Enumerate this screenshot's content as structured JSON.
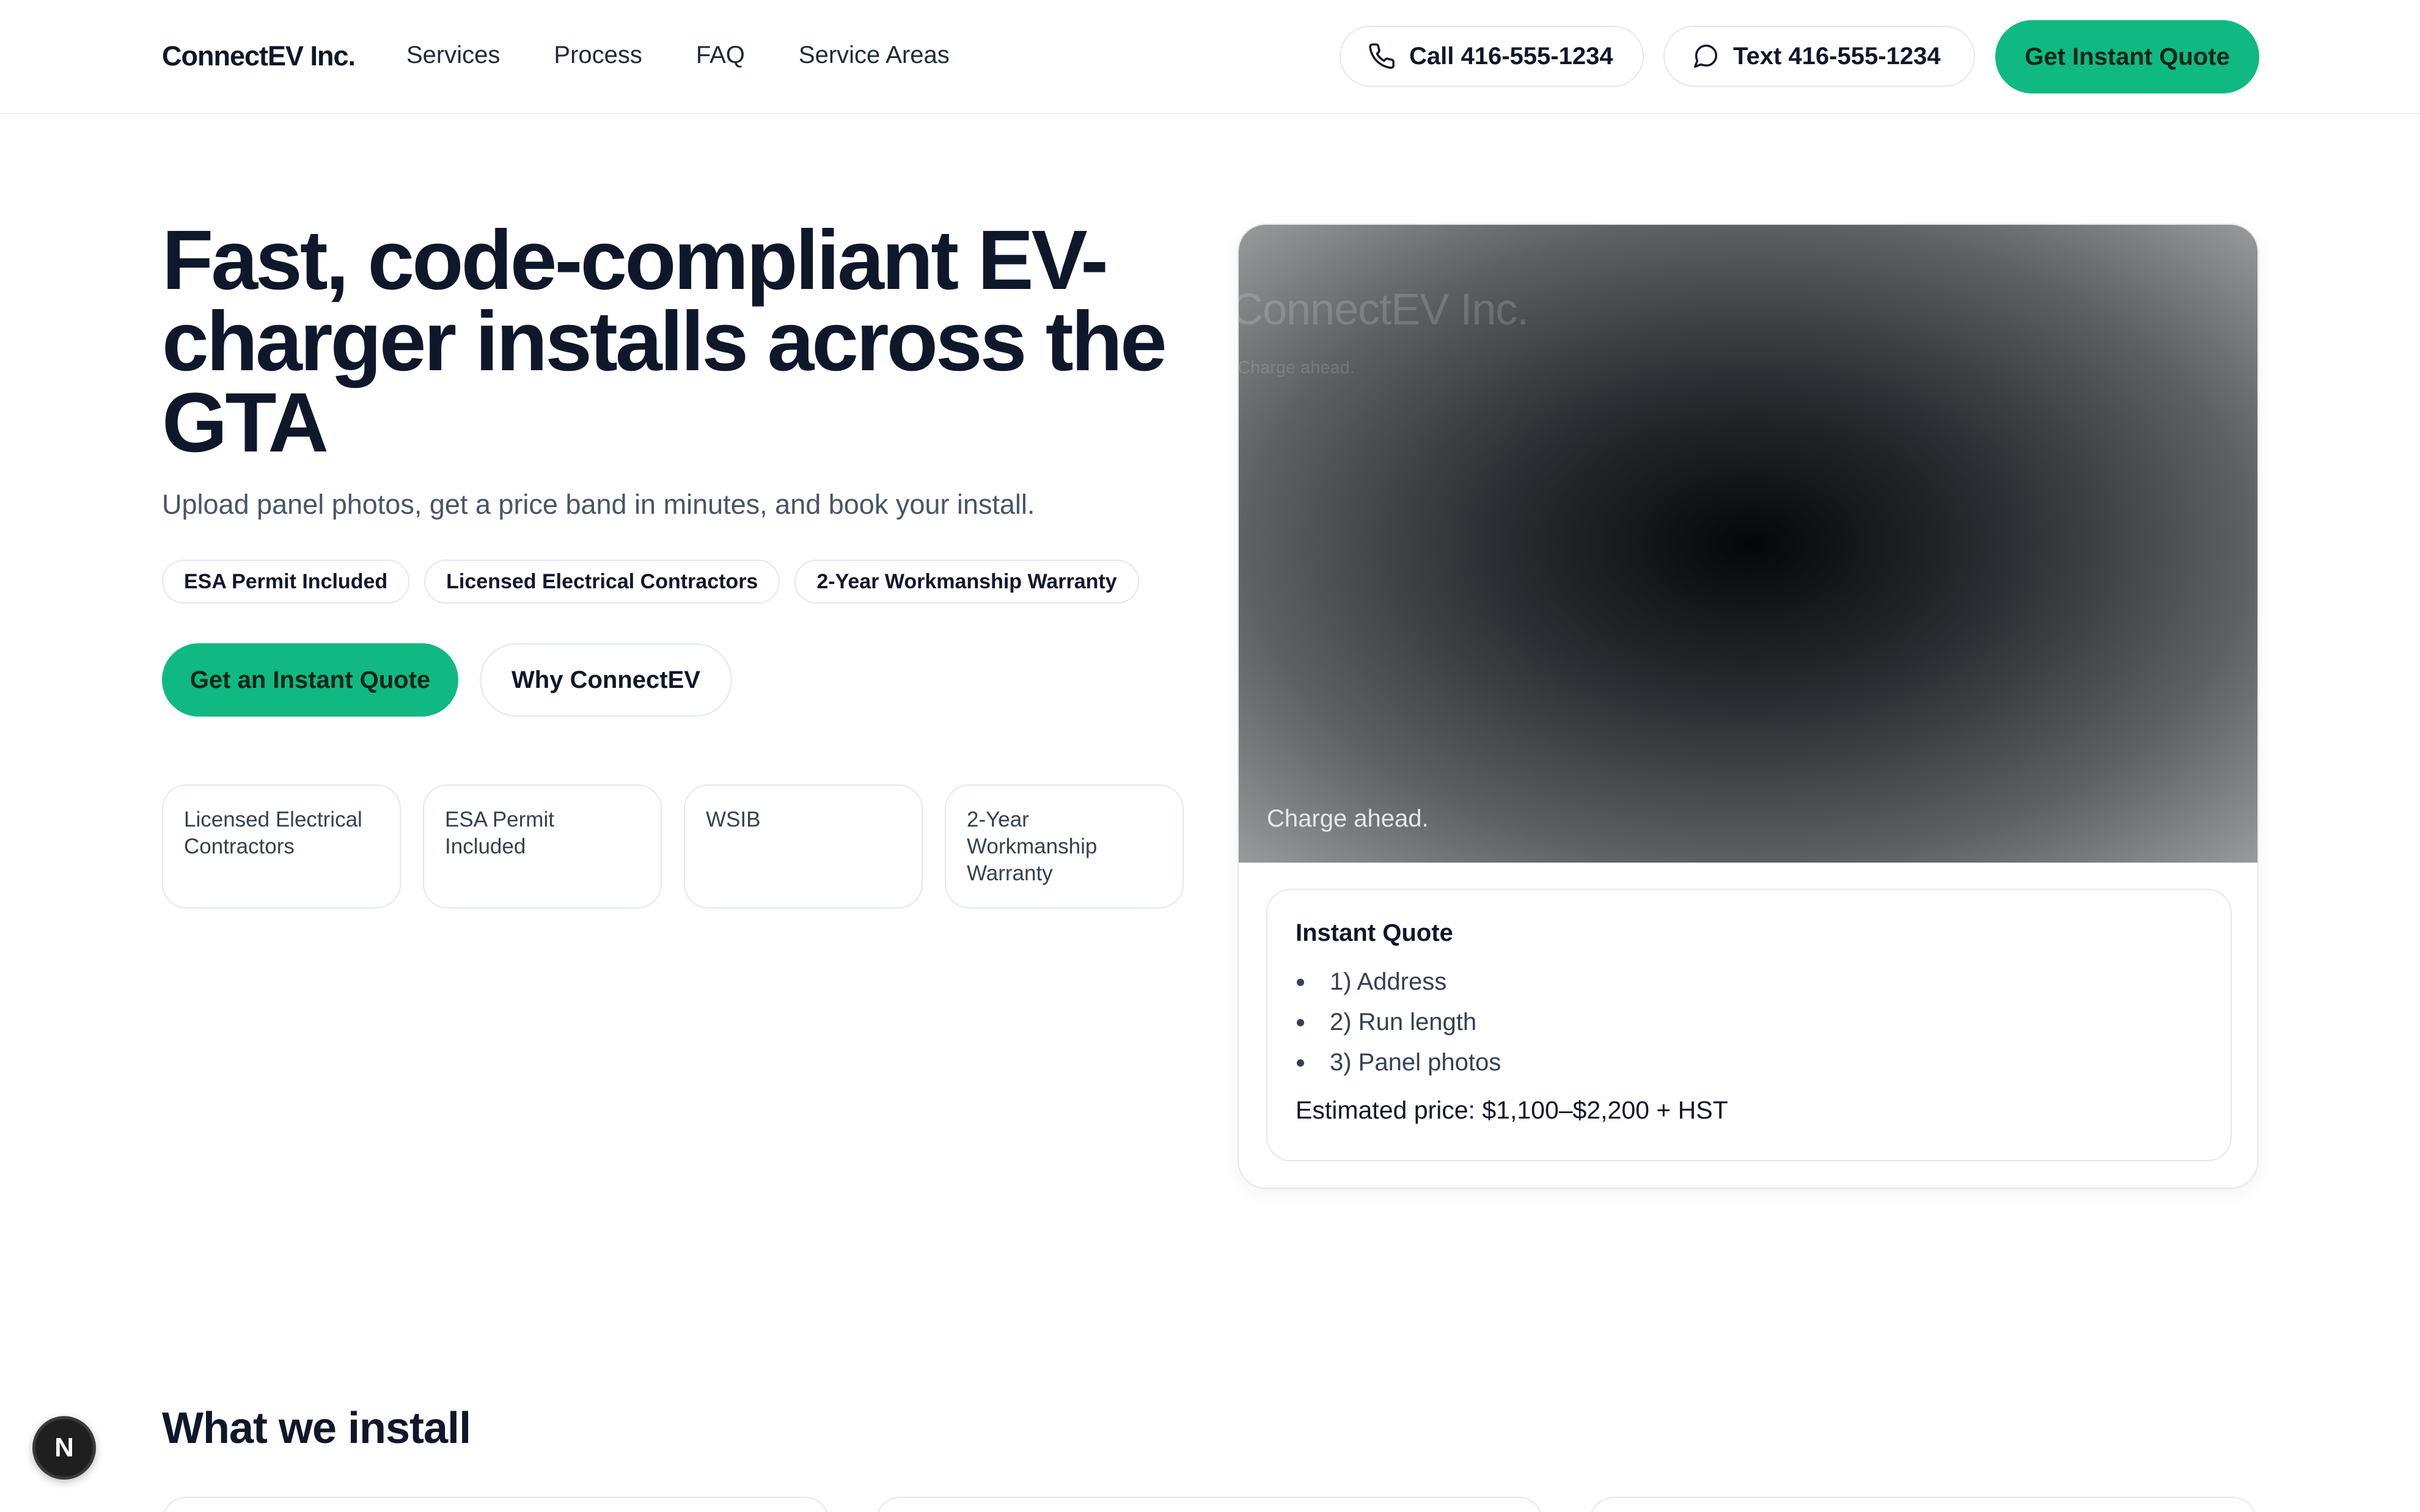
{
  "header": {
    "logo": "ConnectEV Inc.",
    "nav": [
      "Services",
      "Process",
      "FAQ",
      "Service Areas"
    ],
    "call_label": "Call 416-555-1234",
    "text_label": "Text 416-555-1234",
    "cta_label": "Get Instant Quote",
    "call_icon": "phone-icon",
    "text_icon": "chat-bubble-icon"
  },
  "hero": {
    "title": "Fast, code-compliant EV-charger installs across the GTA",
    "subtitle": "Upload panel photos, get a price band in minutes, and book your install.",
    "badges": [
      "ESA Permit Included",
      "Licensed Electrical Contractors",
      "2-Year Workmanship Warranty"
    ],
    "primary_button": "Get an Instant Quote",
    "secondary_button": "Why ConnectEV",
    "trust_cards": [
      "Licensed Electrical Contractors",
      "ESA Permit Included",
      "WSIB",
      "2-Year Workmanship Warranty"
    ]
  },
  "hero_image": {
    "brand": "ConnectEV Inc.",
    "tagline": "Charge ahead.",
    "caption": "Charge ahead."
  },
  "quote": {
    "title": "Instant Quote",
    "steps": [
      "1) Address",
      "2) Run length",
      "3) Panel photos"
    ],
    "price": "Estimated price: $1,100–$2,200 + HST"
  },
  "section": {
    "title": "What we install"
  },
  "dev_badge": {
    "label": "N"
  },
  "colors": {
    "accent": "#10b981",
    "text": "#0f172a",
    "muted": "#475569",
    "border": "#e2e8f0"
  }
}
